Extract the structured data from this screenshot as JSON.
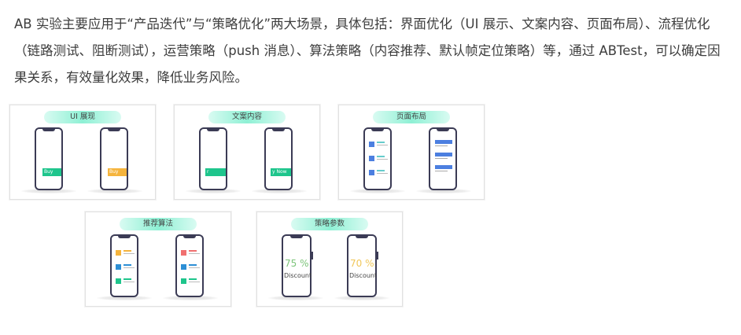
{
  "intro": {
    "text": "AB 实验主要应用于“产品迭代”与“策略优化”两大场景，具体包括：界面优化（UI 展示、文案内容、页面布局）、流程优化（链路测试、阻断测试），运营策略（push 消息）、算法策略（内容推荐、默认帧定位策略）等，通过 ABTest，可以确定因果关系，有效量化效果，降低业务风险。"
  },
  "cards": {
    "ui": {
      "title": "UI 展现",
      "phone_a_button": "Buy",
      "phone_b_button": "Buy",
      "phone_a_color": "#1ec58c",
      "phone_b_color": "#f5b43d"
    },
    "copy": {
      "title": "文案内容",
      "phone_a_button": "r",
      "phone_b_button": "y Now",
      "button_color": "#1ec58c"
    },
    "layout": {
      "title": "页面布局",
      "accent": "#4c7fe0"
    },
    "recommend": {
      "title": "推荐算法",
      "phone_a_colors": [
        "#f5b43d",
        "#2d8fd5",
        "#1ec58c"
      ],
      "phone_b_colors": [
        "#f07070",
        "#2d8fd5",
        "#1ec58c"
      ]
    },
    "strategy": {
      "title": "策略参数",
      "phone_a_value": "75 %",
      "phone_a_label": "Discount",
      "phone_a_color": "#7cc47a",
      "phone_b_value": "70 %",
      "phone_b_label": "Discount",
      "phone_b_color": "#f0c75a"
    }
  }
}
